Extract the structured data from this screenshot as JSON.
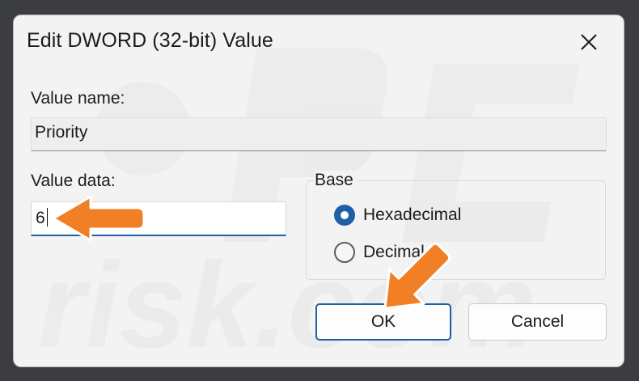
{
  "window": {
    "title": "Edit DWORD (32-bit) Value",
    "close_icon": "close-icon"
  },
  "value_name": {
    "label": "Value name:",
    "value": "Priority"
  },
  "value_data": {
    "label": "Value data:",
    "value": "6"
  },
  "base": {
    "legend": "Base",
    "options": [
      {
        "label": "Hexadecimal",
        "checked": true
      },
      {
        "label": "Decimal",
        "checked": false
      }
    ]
  },
  "buttons": {
    "ok_label": "OK",
    "cancel_label": "Cancel"
  },
  "colors": {
    "accent": "#1f5fa8",
    "annotation_arrow": "#f07f25",
    "dialog_background": "#f3f3f3"
  }
}
